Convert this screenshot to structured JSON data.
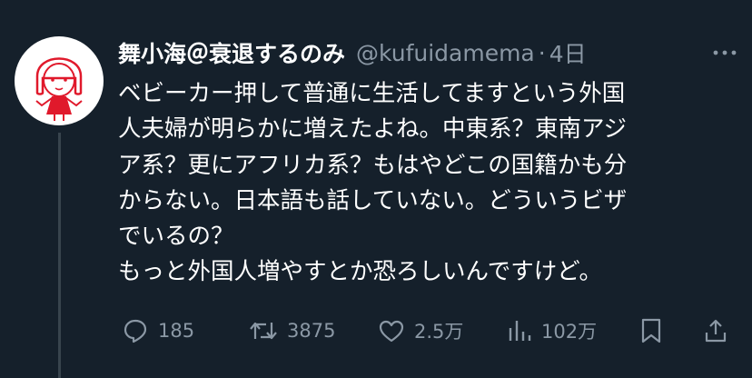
{
  "tweet": {
    "author": {
      "display_name": "舞小海＠衰退するのみ",
      "handle": "@kufuidamema",
      "avatar_icon": "avatar-illustration-icon"
    },
    "separator": "·",
    "timestamp": "4日",
    "text_lines": [
      "ベビーカー押して普通に生活してますという外国",
      "人夫婦が明らかに増えたよね。中東系？東南アジ",
      "ア系？更にアフリカ系？もはやどこの国籍かも分",
      "からない。日本語も話していない。どういうビザ",
      "でいるの？",
      "もっと外国人増やすとか恐ろしいんですけど。"
    ],
    "actions": {
      "replies": "185",
      "reposts": "3875",
      "likes": "2.5万",
      "views": "102万"
    }
  },
  "colors": {
    "background": "#15202b",
    "text_primary": "#ffffff",
    "text_secondary": "#8b98a5",
    "thread_line": "#38444d",
    "avatar_accent": "#e0192b"
  }
}
